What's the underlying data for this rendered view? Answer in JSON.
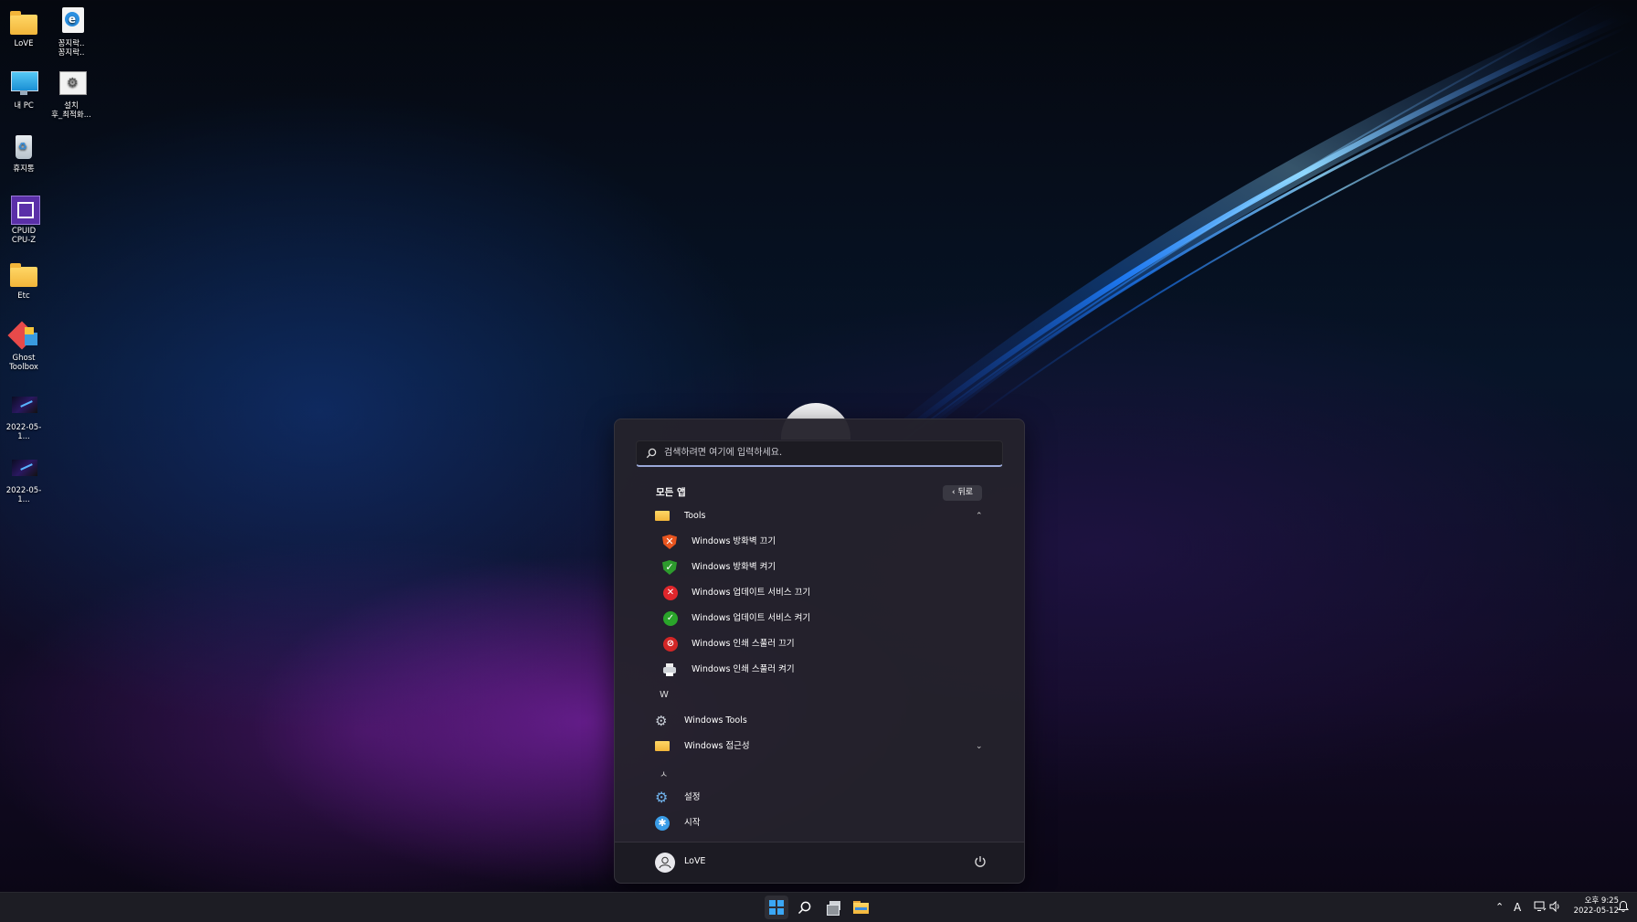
{
  "desktop": {
    "icons": [
      {
        "label": "LoVE",
        "icon": "folder-icon"
      },
      {
        "label": "꽁지락..\n꽁지락..",
        "icon": "internet-explorer-icon"
      },
      {
        "label": "내 PC",
        "icon": "monitor-icon"
      },
      {
        "label": "설치\n후_최적화...",
        "icon": "settings-shortcut-icon"
      },
      {
        "label": "휴지통",
        "icon": "recycle-bin-icon"
      },
      {
        "label": "CPUID\nCPU-Z",
        "icon": "cpu-z-icon"
      },
      {
        "label": "Etc",
        "icon": "folder-icon"
      },
      {
        "label": "Ghost\nToolbox",
        "icon": "ghost-toolbox-icon"
      },
      {
        "label": "2022-05-1...",
        "icon": "image-file-icon"
      },
      {
        "label": "2022-05-1...",
        "icon": "image-file-icon"
      }
    ]
  },
  "start_menu": {
    "search_placeholder": "검색하려면 여기에 입력하세요.",
    "header": "모든 앱",
    "back_label": "뒤로",
    "folder_tools": "Tools",
    "tools_items": [
      "Windows 방화벽 끄기",
      "Windows 방화벽 켜기",
      "Windows 업데이트 서비스 끄기",
      "Windows 업데이트 서비스 켜기",
      "Windows 인쇄 스풀러 끄기",
      "Windows 인쇄 스풀러 켜기"
    ],
    "letter_w": "W",
    "windows_tools": "Windows Tools",
    "windows_accessibility": "Windows 접근성",
    "letter_hangul": "ㅅ",
    "settings": "설정",
    "start": "시작",
    "user_name": "LoVE"
  },
  "taskbar": {
    "ime": "A",
    "clock_time": "오후 9:25",
    "clock_date": "2022-05-12"
  },
  "colors": {
    "accent_blue": "#4aa8ff",
    "shield_orange": "#e8551f",
    "shield_green": "#2d9b2d",
    "red": "#e0262b",
    "green": "#2aa52a"
  }
}
